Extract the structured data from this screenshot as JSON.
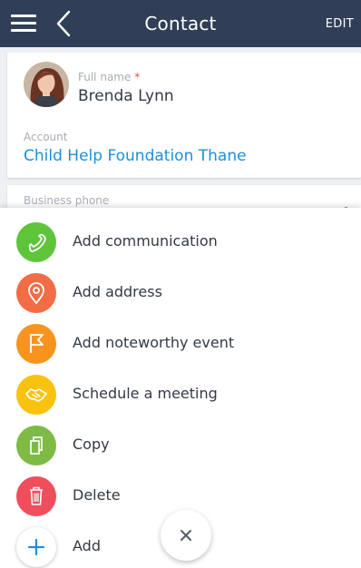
{
  "header": {
    "title": "Contact",
    "edit_label": "EDIT"
  },
  "contact": {
    "full_name_label": "Full name",
    "required_mark": "*",
    "full_name": "Brenda Lynn",
    "account_label": "Account",
    "account": "Child Help Foundation Thane",
    "business_phone_label": "Business phone"
  },
  "actions": [
    {
      "label": "Add communication",
      "icon": "phone-icon",
      "color": "#5ec53b"
    },
    {
      "label": "Add address",
      "icon": "location-pin-icon",
      "color": "#f26c46"
    },
    {
      "label": "Add noteworthy event",
      "icon": "flag-icon",
      "color": "#f7941d"
    },
    {
      "label": "Schedule a meeting",
      "icon": "handshake-icon",
      "color": "#f9c20f"
    },
    {
      "label": "Copy",
      "icon": "copy-icon",
      "color": "#7dbb45"
    },
    {
      "label": "Delete",
      "icon": "trash-icon",
      "color": "#ef4e5c"
    },
    {
      "label": "Add",
      "icon": "plus-icon",
      "color": "#ffffff"
    }
  ],
  "close_icon": "close-icon",
  "colors": {
    "header": "#303e57",
    "link": "#1e8fd8",
    "required": "#e2563a"
  }
}
